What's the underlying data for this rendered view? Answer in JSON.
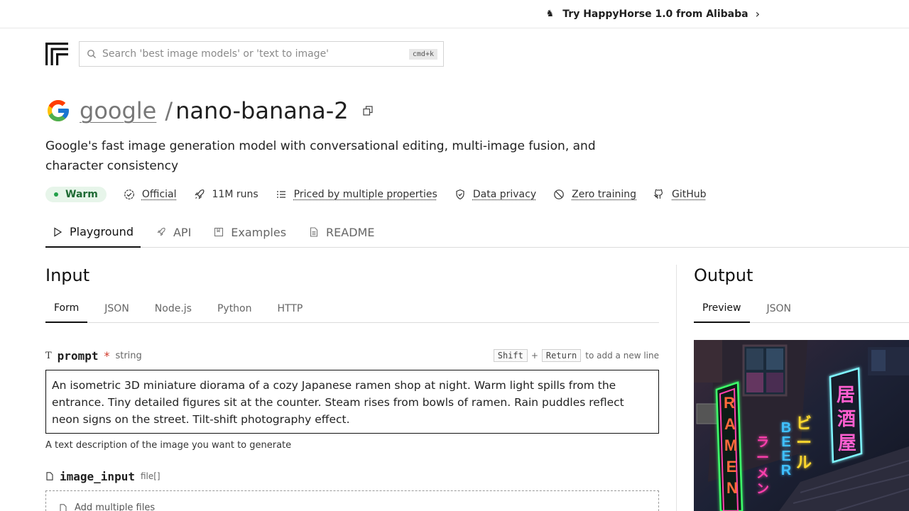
{
  "banner": {
    "text": "Try HappyHorse 1.0 from Alibaba"
  },
  "search": {
    "placeholder": "Search 'best image models' or 'text to image'",
    "shortcut": "cmd+k"
  },
  "model": {
    "owner": "google",
    "separator": "/",
    "name": "nano-banana-2",
    "description": "Google's fast image generation model with conversational editing, multi-image fusion, and character consistency"
  },
  "badges": {
    "status": "Warm",
    "official": "Official",
    "runs": "11M runs",
    "pricing": "Priced by multiple properties",
    "privacy": "Data privacy",
    "training": "Zero training",
    "github": "GitHub"
  },
  "tabs": [
    "Playground",
    "API",
    "Examples",
    "README"
  ],
  "input": {
    "heading": "Input",
    "subtabs": [
      "Form",
      "JSON",
      "Node.js",
      "Python",
      "HTTP"
    ],
    "prompt": {
      "name": "prompt",
      "required_mark": "*",
      "type": "string",
      "hint_key1": "Shift",
      "hint_plus": "+",
      "hint_key2": "Return",
      "hint_text": "to add a new line",
      "value": "An isometric 3D miniature diorama of a cozy Japanese ramen shop at night. Warm light spills from the entrance. Tiny detailed figures sit at the counter. Steam rises from bowls of ramen. Rain puddles reflect neon signs on the street. Tilt-shift photography effect.",
      "description": "A text description of the image you want to generate"
    },
    "image_input": {
      "name": "image_input",
      "type": "file[]",
      "dropzone": "Add multiple files"
    }
  },
  "output": {
    "heading": "Output",
    "subtabs": [
      "Preview",
      "JSON"
    ],
    "signs": {
      "ramen": "RAMEN",
      "beer": "BEER",
      "biru": "ビール",
      "ramen_jp": "ラーメン",
      "izakaya": "居酒屋"
    },
    "colors": {
      "pink": "#ff3fae",
      "green": "#3cff6a",
      "blue": "#3fc0ff",
      "yellow": "#ffd92e",
      "cyan": "#7ff6ff"
    }
  }
}
